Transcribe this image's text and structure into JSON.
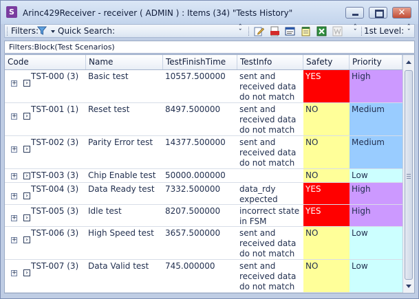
{
  "window": {
    "app_icon": "S",
    "title": "Arinc429Receiver - receiver ( ADMIN ) : Items (34) \"Tests History\"",
    "controls": [
      "minimize-icon",
      "maximize-icon",
      "close-icon"
    ]
  },
  "toolbar": {
    "filters_label": "Filters:",
    "quick_search_label": "Quick Search:",
    "level_label": "1st Level:",
    "icons": [
      "funnel-icon",
      "edit-icon",
      "pdf-icon",
      "form-icon",
      "notepad-icon",
      "excel-icon",
      "word-icon"
    ]
  },
  "filter_bar": {
    "text": "Filters:Block(Test Scenarios)"
  },
  "table": {
    "columns": [
      "Code",
      "Name",
      "TestFinishTime",
      "TestInfo",
      "Safety",
      "Priority"
    ],
    "colors": {
      "YES": "#ff0000",
      "NO": "#ffff99",
      "High": "#cc99ff",
      "Medium": "#99ccff",
      "Low": "#ccffff"
    },
    "rows": [
      {
        "code": "TST-000 (3)",
        "name": "Basic test",
        "time": "10557.500000",
        "info": "sent and received data do not match",
        "safety": "YES",
        "priority": "High"
      },
      {
        "code": "TST-001 (1)",
        "name": "Reset  test",
        "time": "8497.500000",
        "info": "sent and received data do not match",
        "safety": "NO",
        "priority": "Medium"
      },
      {
        "code": "TST-002 (3)",
        "name": "Parity Error test",
        "time": "14377.500000",
        "info": "sent and received data do not match",
        "safety": "NO",
        "priority": "Medium"
      },
      {
        "code": "TST-003 (3)",
        "name": "Chip Enable test",
        "time": "50000.000000",
        "info": "",
        "safety": "NO",
        "priority": "Low"
      },
      {
        "code": "TST-004 (3)",
        "name": "Data Ready test",
        "time": "7332.500000",
        "info": "data_rdy expected",
        "safety": "YES",
        "priority": "High"
      },
      {
        "code": "TST-005 (3)",
        "name": "Idle test",
        "time": "8207.500000",
        "info": "incorrect state in FSM",
        "safety": "YES",
        "priority": "High"
      },
      {
        "code": "TST-006 (3)",
        "name": "High Speed test",
        "time": "3657.500000",
        "info": "sent and received data do not match",
        "safety": "NO",
        "priority": "Low"
      },
      {
        "code": "TST-007 (3)",
        "name": "Data Valid test",
        "time": "745.000000",
        "info": "sent and received data do not match",
        "safety": "NO",
        "priority": "Low"
      }
    ]
  }
}
